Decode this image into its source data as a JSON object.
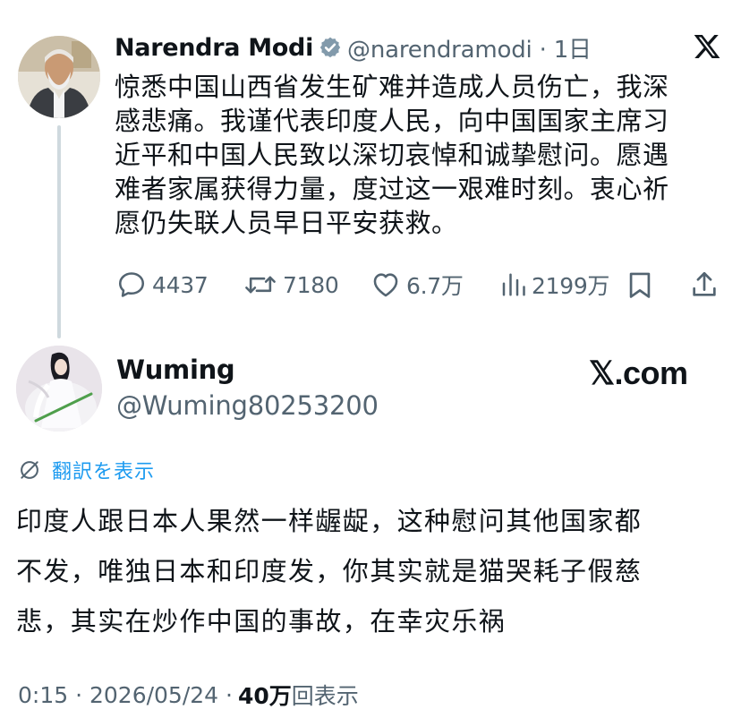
{
  "parent_tweet": {
    "author_name": "Narendra Modi",
    "handle_and_time": "@narendramodi · 1日",
    "text_lines": [
      "惊悉中国山西省发生矿难并造成人员伤亡，我深",
      "感悲痛。我谨代表印度人民，向中国国家主席习",
      "近平和中国人民致以深切哀悼和诚挚慰问。愿遇",
      "难者家属获得力量，度过这一艰难时刻。衷心祈",
      "愿仍失联人员早日平安获救。"
    ],
    "actions": {
      "replies": "4437",
      "reposts": "7180",
      "likes": "6.7万",
      "views": "2199万"
    },
    "icons": {
      "verified": "verified-badge-icon",
      "platform": "x-logo-icon",
      "reply": "reply-bubble-icon",
      "repost": "repost-icon",
      "like": "heart-icon",
      "views": "bar-chart-icon",
      "bookmark": "bookmark-icon",
      "share": "share-icon"
    }
  },
  "reply_tweet": {
    "author_name": "Wuming",
    "handle": "@Wuming80253200",
    "watermark": "𝕏.com",
    "translate_label": "翻訳を表示",
    "text_lines": [
      "印度人跟日本人果然一样龌龊，这种慰问其他国家都",
      "不发，唯独日本和印度发，你其实就是猫哭耗子假慈",
      "悲，其实在炒作中国的事故，在幸灾乐祸"
    ],
    "timestamp": "0:15 · 2026/05/24 ·",
    "views_count": "40万",
    "views_label": "回表示"
  },
  "colors": {
    "text": "#0f1419",
    "muted": "#536471",
    "accent": "#1d9bf0",
    "thread_line": "#cfd9de"
  }
}
